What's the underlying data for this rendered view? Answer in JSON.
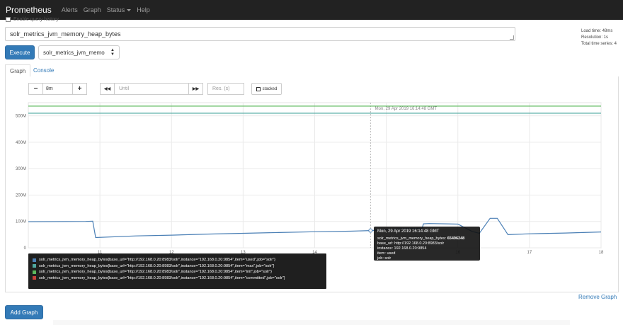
{
  "nav": {
    "brand": "Prometheus",
    "alerts": "Alerts",
    "graph": "Graph",
    "status": "Status",
    "help": "Help"
  },
  "history_label": "Enable query history",
  "expression": "solr_metrics_jvm_memory_heap_bytes",
  "stats": {
    "load_time": "Load time: 48ms",
    "resolution": "Resolution: 1s",
    "total_series": "Total time series: 4"
  },
  "execute_label": "Execute",
  "metric_select_value": "solr_metrics_jvm_memo",
  "tabs": {
    "graph": "Graph",
    "console": "Console"
  },
  "controls": {
    "minus": "−",
    "range": "8m",
    "plus": "+",
    "back": "◀◀",
    "until_placeholder": "Until",
    "forward": "▶▶",
    "res_placeholder": "Res. (s)",
    "stacked": "stacked"
  },
  "hover_time_label": "Mon, 29 Apr 2019 16:14:48 GMT",
  "tooltip": {
    "time": "Mon, 29 Apr 2019 16:14:48 GMT",
    "line1_key": "solr_metrics_jvm_memory_heap_bytes:",
    "line1_val": "65496248",
    "base_url": "base_url: http://192.168.0.20:8983/solr",
    "instance": "instance: 192.168.0.20:9854",
    "item": "item: used",
    "job": "job: solr"
  },
  "legend": [
    {
      "label": "solr_metrics_jvm_memory_heap_bytes{base_url=\"http://192.168.0.20:8983/solr\",instance=\"192.168.0.20:9854\",item=\"used\",job=\"solr\"}",
      "color": "#4a7fb5"
    },
    {
      "label": "solr_metrics_jvm_memory_heap_bytes{base_url=\"http://192.168.0.20:8983/solr\",instance=\"192.168.0.20:9854\",item=\"max\",job=\"solr\"}",
      "color": "#4fa8a0"
    },
    {
      "label": "solr_metrics_jvm_memory_heap_bytes{base_url=\"http://192.168.0.20:8983/solr\",instance=\"192.168.0.20:9854\",item=\"init\",job=\"solr\"}",
      "color": "#5cb85c"
    },
    {
      "label": "solr_metrics_jvm_memory_heap_bytes{base_url=\"http://192.168.0.20:8983/solr\",instance=\"192.168.0.20:9854\",item=\"committed\",job=\"solr\"}",
      "color": "#c9413b"
    }
  ],
  "remove_graph": "Remove Graph",
  "add_graph": "Add Graph",
  "chart_data": {
    "type": "line",
    "x_ticks": [
      "11",
      "12",
      "13",
      "14",
      "15",
      "16",
      "17",
      "18"
    ],
    "y_ticks": [
      "0",
      "100M",
      "200M",
      "300M",
      "400M",
      "500M"
    ],
    "ylim": [
      0,
      550000000
    ],
    "xlim": [
      10.0,
      18.0
    ],
    "grid": true,
    "series": [
      {
        "name": "used",
        "color": "#4a7fb5",
        "x": [
          10.0,
          10.8,
          10.9,
          10.94,
          11.5,
          12.0,
          12.5,
          13.0,
          13.5,
          14.0,
          14.5,
          14.78,
          14.9,
          15.0,
          15.2,
          15.5,
          15.52,
          15.6,
          16.0,
          16.2,
          16.3,
          16.45,
          16.55,
          16.7,
          17.0,
          17.5,
          18.0
        ],
        "y": [
          99000000,
          100000000,
          101000000,
          39000000,
          45000000,
          48000000,
          52000000,
          55000000,
          58000000,
          61000000,
          63000000,
          65496248,
          67000000,
          69000000,
          72000000,
          74000000,
          91000000,
          92000000,
          90000000,
          62000000,
          55000000,
          112000000,
          112000000,
          50000000,
          53000000,
          56000000,
          60000000
        ]
      },
      {
        "name": "max",
        "color": "#4fa8a0",
        "x": [
          10.0,
          18.0
        ],
        "y": [
          510000000,
          510000000
        ]
      },
      {
        "name": "init",
        "color": "#5cb85c",
        "x": [
          10.0,
          18.0
        ],
        "y": [
          536870912,
          536870912
        ]
      },
      {
        "name": "committed",
        "color": "#c9413b",
        "x": [],
        "y": []
      }
    ]
  }
}
